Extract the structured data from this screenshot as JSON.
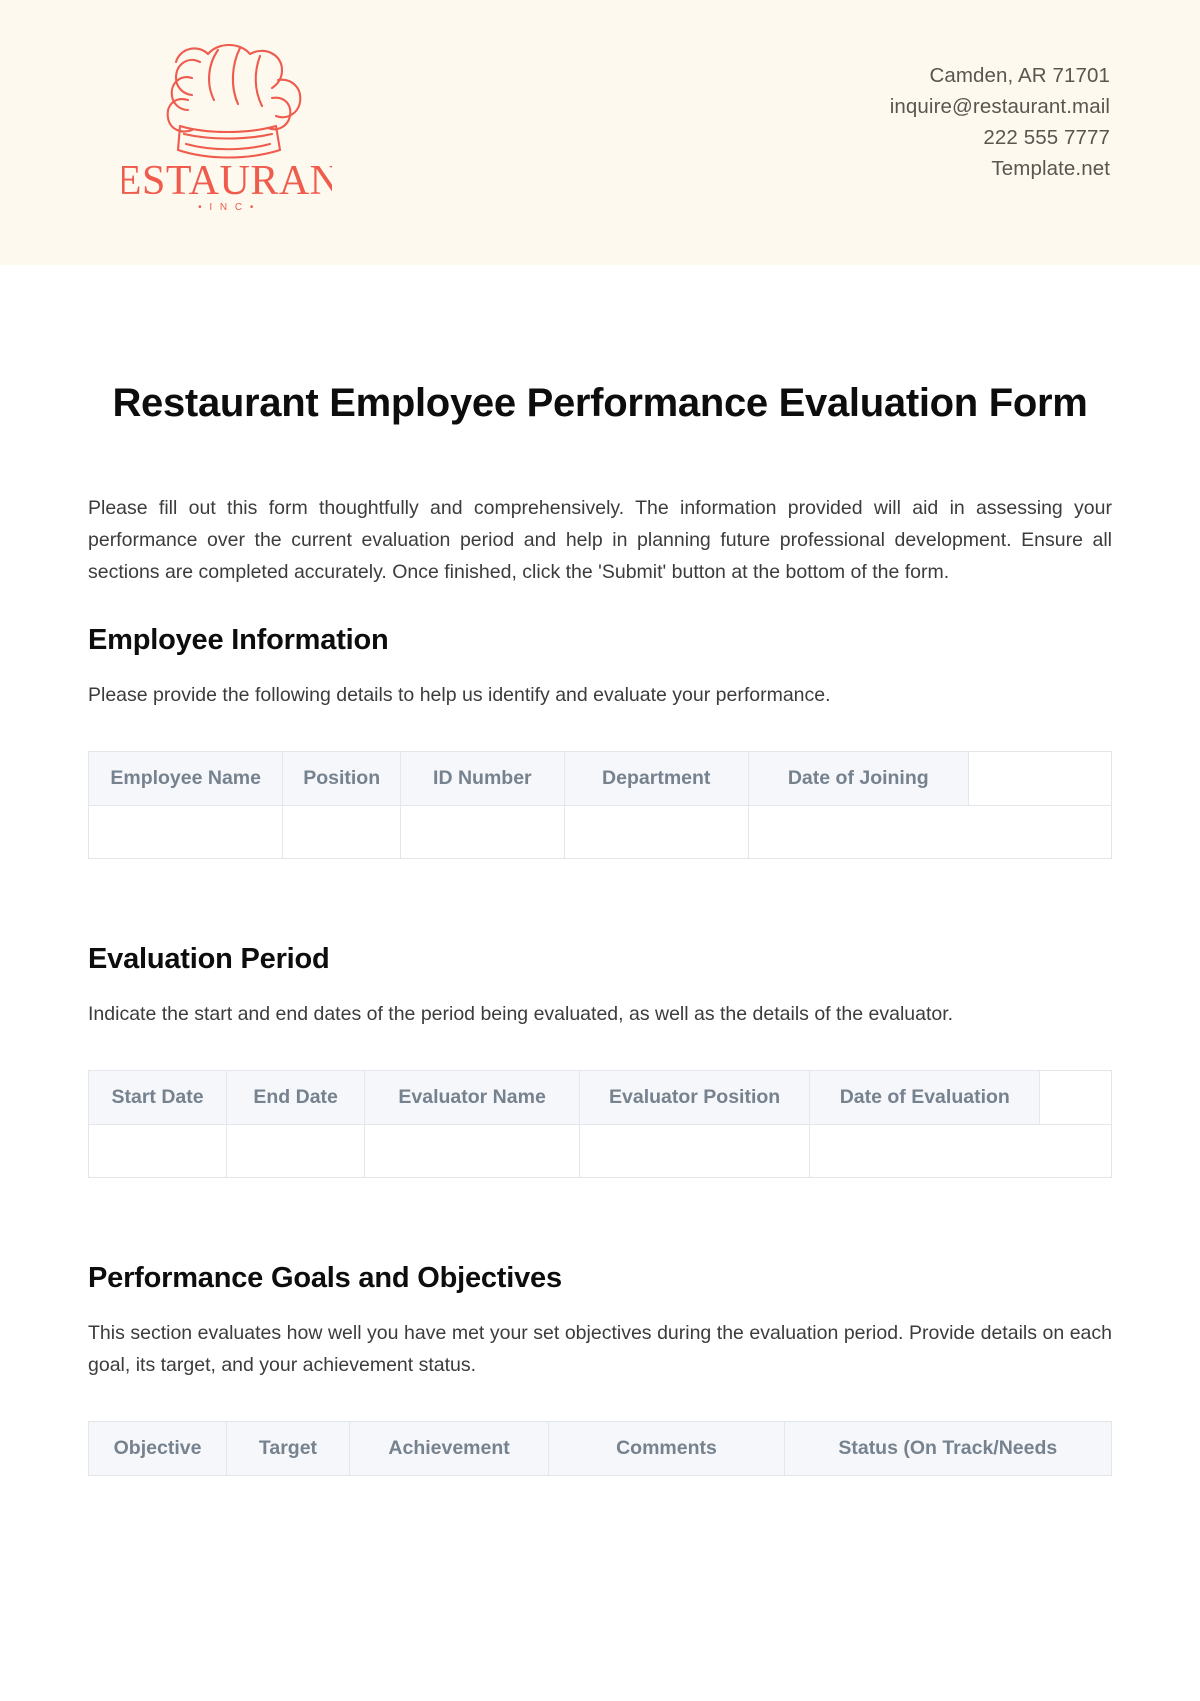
{
  "brand": {
    "logo_icon": "chef-hat-icon",
    "name": "RESTAURANT",
    "suffix": "• I N C •",
    "color": "#ef5b4c"
  },
  "header": {
    "band_color": "#fdf9ef",
    "contact": [
      "Camden, AR 71701",
      "inquire@restaurant.mail",
      "222 555 7777",
      "Template.net"
    ]
  },
  "document": {
    "title": "Restaurant Employee Performance Evaluation Form",
    "intro": "Please fill out this form thoughtfully and comprehensively. The information provided will aid in assessing your performance over the current evaluation period and help in planning future professional development. Ensure all sections are completed accurately. Once finished, click the 'Submit' button at the bottom of the form."
  },
  "sections": [
    {
      "heading": "Employee Information",
      "description": "Please provide the following details to help us identify and evaluate your performance.",
      "table": {
        "columns": [
          "Employee Name",
          "Position",
          "ID Number",
          "Department",
          "Date of Joining"
        ],
        "widths": [
          "19.0%",
          "11.5%",
          "16.0%",
          "18.0%",
          "21.5%",
          "14.0%"
        ],
        "rows": [
          [
            "",
            "",
            "",
            "",
            ""
          ]
        ]
      }
    },
    {
      "heading": "Evaluation Period",
      "description": "Indicate the start and end dates of the period being evaluated, as well as the details of the evaluator.",
      "table": {
        "columns": [
          "Start Date",
          "End Date",
          "Evaluator Name",
          "Evaluator Position",
          "Date of Evaluation"
        ],
        "widths": [
          "13.5%",
          "13.5%",
          "21.0%",
          "22.5%",
          "22.5%",
          "7.0%"
        ],
        "rows": [
          [
            "",
            "",
            "",
            "",
            ""
          ]
        ]
      }
    },
    {
      "heading": "Performance Goals and Objectives",
      "description": "This section evaluates how well you have met your set objectives during the evaluation period. Provide details on each goal, its target, and your achievement status.",
      "table": {
        "columns": [
          "Objective",
          "Target",
          "Achievement",
          "Comments",
          "Status (On Track/Needs"
        ],
        "widths": [
          "13.5%",
          "12.0%",
          "19.5%",
          "23.0%",
          "30.0%",
          "2.0%"
        ],
        "rows": []
      }
    }
  ],
  "colors": {
    "accent": "#ef5b4c",
    "header_band": "#fdf9ef",
    "table_header_bg": "#f5f7fa",
    "table_header_text": "#77828f",
    "table_border": "#e3e6ea",
    "body_text": "#3c3c3c",
    "heading_text": "#0d0d0d",
    "contact_text": "#5a564f"
  }
}
